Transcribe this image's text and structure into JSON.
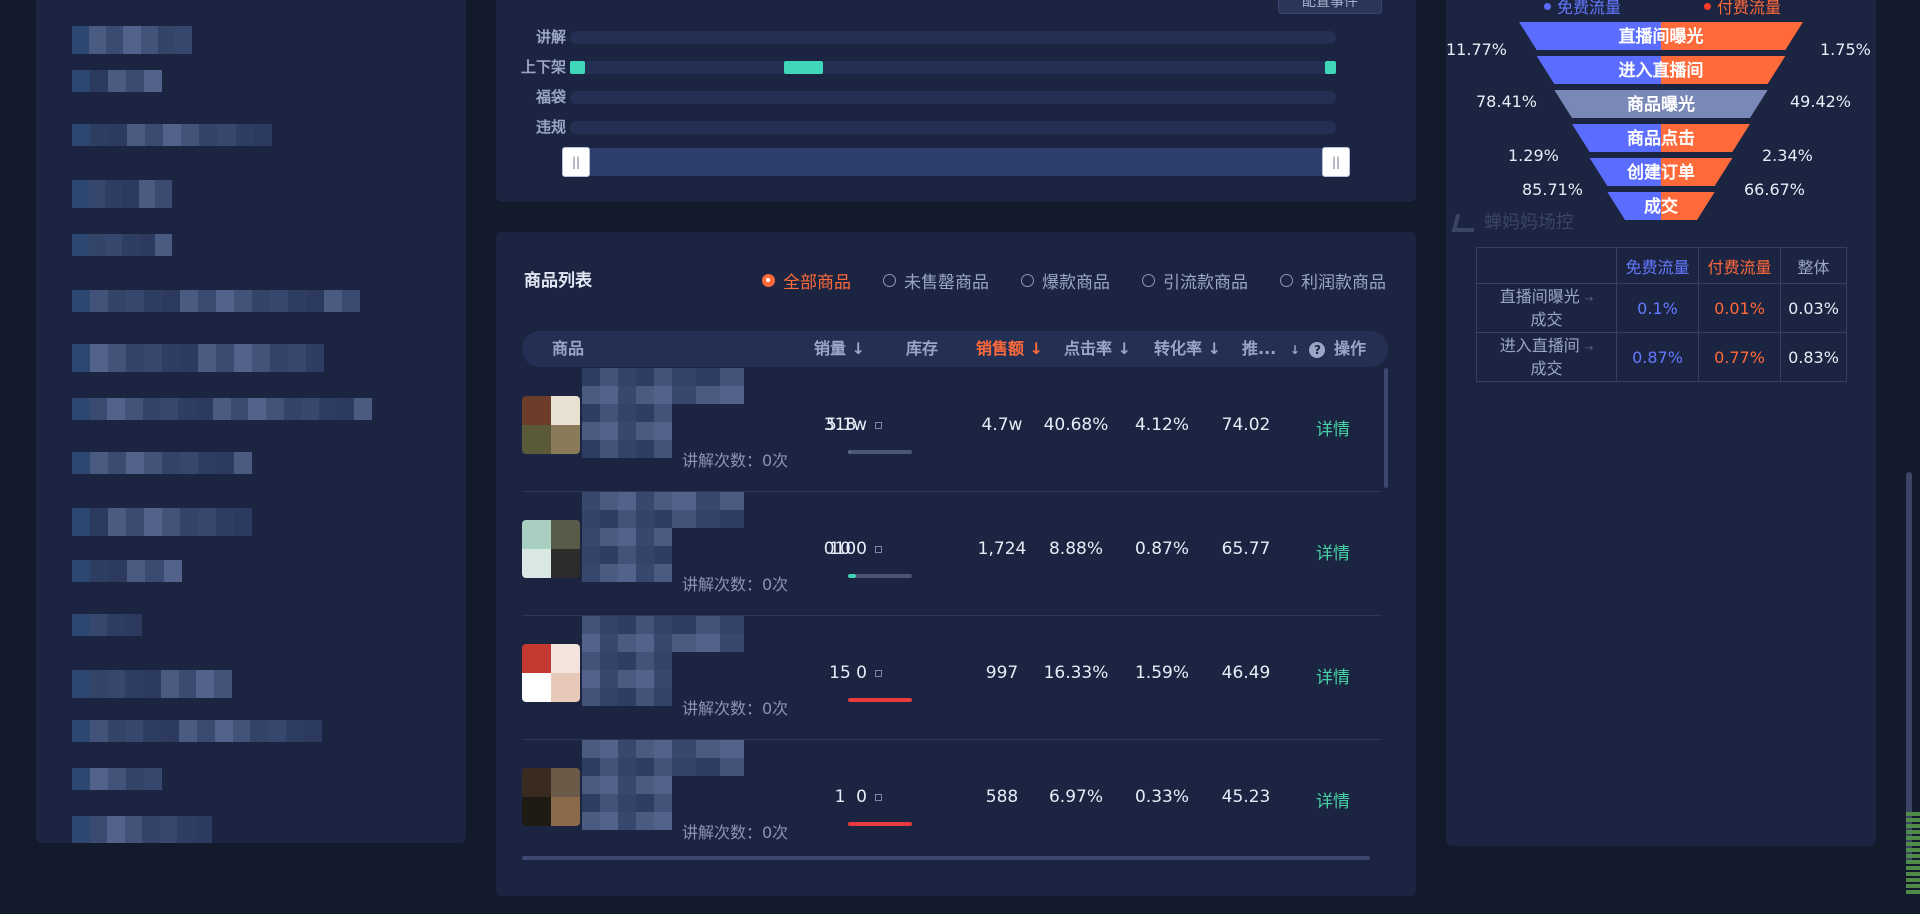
{
  "timeline": {
    "config_button": "配置事件",
    "tracks": [
      {
        "label": "讲解",
        "segments": []
      },
      {
        "label": "上下架",
        "segments": [
          [
            0.0,
            0.02
          ],
          [
            0.28,
            0.33
          ],
          [
            0.985,
            1.0
          ]
        ]
      },
      {
        "label": "福袋",
        "segments": []
      },
      {
        "label": "违规",
        "segments": []
      }
    ],
    "handle_glyph": "||"
  },
  "product_list": {
    "title": "商品列表",
    "filters": [
      {
        "label": "全部商品",
        "active": true
      },
      {
        "label": "未售罄商品",
        "active": false
      },
      {
        "label": "爆款商品",
        "active": false
      },
      {
        "label": "引流款商品",
        "active": false
      },
      {
        "label": "利润款商品",
        "active": false
      }
    ],
    "headers": {
      "product": "商品",
      "sales": "销量 ↓",
      "stock": "库存",
      "revenue": "销售额 ↓",
      "ctr": "点击率 ↓",
      "cvr": "转化率 ↓",
      "rec": "推...",
      "help": "?",
      "sort_mark": "↓",
      "action": "操作"
    },
    "explain_label": "讲解次数：0次",
    "detail_label": "详情",
    "rows": [
      {
        "sales": "318",
        "stock": "5.1w",
        "stock_level": 0.04,
        "stock_color": "#5d6787",
        "revenue": "4.7w",
        "ctr": "40.68%",
        "cvr": "4.12%",
        "rec": "74.02",
        "thumb_colors": [
          "#6b3d2a",
          "#e8e0d0",
          "#5a5a3a",
          "#8a7a5a"
        ]
      },
      {
        "sales": "10",
        "stock": "0100",
        "stock_level": 0.12,
        "stock_color": "#3fd6b9",
        "revenue": "1,724",
        "ctr": "8.88%",
        "cvr": "0.87%",
        "rec": "65.77",
        "thumb_colors": [
          "#a8cfc0",
          "#5a5a48",
          "#d9e8e0",
          "#2c2c2a"
        ]
      },
      {
        "sales": "15",
        "stock": "0",
        "stock_level": 1.0,
        "stock_color": "#e83a3a",
        "revenue": "997",
        "ctr": "16.33%",
        "cvr": "1.59%",
        "rec": "46.49",
        "thumb_colors": [
          "#c43a32",
          "#f2e4dc",
          "#ffffff",
          "#e8c8b8"
        ]
      },
      {
        "sales": "1",
        "stock": "0",
        "stock_level": 1.0,
        "stock_color": "#e83a3a",
        "revenue": "588",
        "ctr": "6.97%",
        "cvr": "0.33%",
        "rec": "45.23",
        "thumb_colors": [
          "#3a2a20",
          "#6b5a48",
          "#1e1a14",
          "#8a6a48"
        ]
      }
    ]
  },
  "funnel": {
    "legend": {
      "free": "免费流量",
      "paid": "付费流量"
    },
    "colors": {
      "free": "#5b6dff",
      "paid": "#ff6a3a",
      "overall": "#7a88b8"
    },
    "stages": [
      {
        "label": "直播间曝光",
        "type": "split"
      },
      {
        "label": "进入直播间",
        "type": "split"
      },
      {
        "label": "商品曝光",
        "type": "overall"
      },
      {
        "label": "商品点击",
        "type": "split"
      },
      {
        "label": "创建订单",
        "type": "split"
      },
      {
        "label": "成交",
        "type": "split"
      }
    ],
    "left_rates": [
      "11.77%",
      "78.41%",
      "1.29%",
      "85.71%"
    ],
    "right_rates": [
      "1.75%",
      "49.42%",
      "2.34%",
      "66.67%"
    ],
    "watermark": "蝉妈妈场控",
    "table": {
      "headers": [
        "",
        "免费流量",
        "付费流量",
        "整体"
      ],
      "rows": [
        {
          "label_line1": "直播间曝光",
          "label_line2": "成交",
          "free": "0.1%",
          "paid": "0.01%",
          "overall": "0.03%"
        },
        {
          "label_line1": "进入直播间",
          "label_line2": "成交",
          "free": "0.87%",
          "paid": "0.77%",
          "overall": "0.83%"
        }
      ]
    }
  }
}
